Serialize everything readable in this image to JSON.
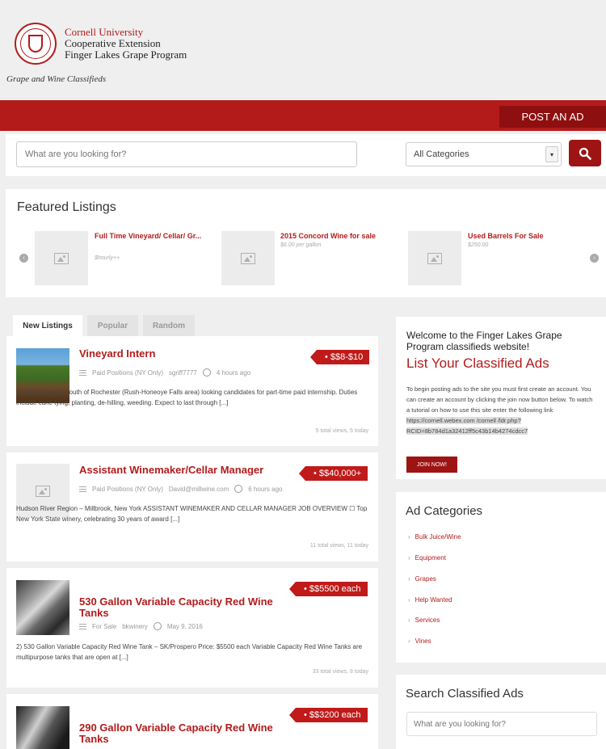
{
  "header": {
    "org_line1": "Cornell University",
    "org_line2": "Cooperative Extension",
    "org_line3": "Finger Lakes Grape Program",
    "tagline": "Grape and Wine Classifieds"
  },
  "nav": {
    "post_ad_label": "POST AN AD"
  },
  "search": {
    "placeholder": "What are you looking for?",
    "category_selected": "All Categories"
  },
  "featured": {
    "title": "Featured Listings",
    "items": [
      {
        "title": "Full Time Vineyard/ Cellar/ Gr...",
        "sub": "$hourly++"
      },
      {
        "title": "2015 Concord Wine for sale",
        "sub": "$6.00 per gallon"
      },
      {
        "title": "Used Barrels For Sale",
        "sub": "$250.00"
      }
    ]
  },
  "tabs": [
    "New Listings",
    "Popular",
    "Random"
  ],
  "listings": [
    {
      "title": "Vineyard Intern",
      "price": "• $$8-$10",
      "category": "Paid Positions (NY Only)",
      "author": "sgriff7777",
      "time": "4 hours ago",
      "excerpt": "Upstart Vineyard south of Rochester (Rush-Honeoye Falls area) looking candidates for part-time paid internship. Duties include cane tying, planting, de-hilling, weeding. Expect to last through [...]",
      "views": "5 total views, 5 today"
    },
    {
      "title": "Assistant Winemaker/Cellar Manager",
      "price": "• $$40,000+",
      "category": "Paid Positions (NY Only)",
      "author": "David@millwine.com",
      "time": "6 hours ago",
      "excerpt": "Hudson River Region – Millbrook, New York ASSISTANT WINEMAKER AND CELLAR MANAGER JOB OVERVIEW ☐ Top New York State winery, celebrating 30 years of award [...]",
      "views": "11 total views, 11 today"
    },
    {
      "title": "530 Gallon Variable Capacity Red Wine Tanks",
      "price": "• $$5500 each",
      "category": "For Sale",
      "author": "bkwinery",
      "time": "May 9, 2016",
      "excerpt": "2) 530 Gallon Variable Capacity Red Wine Tank – SK/Prospero Price: $5500 each Variable Capacity Red Wine Tanks are multipurpose tanks that are open at [...]",
      "views": "33 total views, 8 today"
    },
    {
      "title": "290 Gallon Variable Capacity Red Wine Tanks",
      "price": "• $$3200 each"
    }
  ],
  "sidebar": {
    "welcome_text": "Welcome to the Finger Lakes Grape Program classifieds website!",
    "welcome_heading": "List Your Classified Ads",
    "welcome_body": "To begin posting ads to the site you must first create an account. You can create an account by clicking the join now button below. To watch a tutorial on how to use this site enter the following link",
    "welcome_link": "https://cornell.webex.com /cornell /ldr.php?RCID=8b784d1a32412ff5c43b14b4274cdcc7",
    "join_label": "JOIN NOW!",
    "categories_heading": "Ad Categories",
    "categories": [
      "Bulk Juice/Wine",
      "Equipment",
      "Grapes",
      "Help Wanted",
      "Services",
      "Vines"
    ],
    "search_heading": "Search Classified Ads",
    "search_placeholder": "What are you looking for?"
  },
  "colors": {
    "brand_red": "#b31b1b",
    "dark_red": "#8e0f0f",
    "background": "#efefef"
  },
  "icons": [
    "cornell-seal-icon",
    "search-icon",
    "chevron-down-icon",
    "image-placeholder-icon",
    "arrow-left-icon",
    "arrow-right-icon",
    "category-icon",
    "clock-icon",
    "chevron-right-icon"
  ]
}
